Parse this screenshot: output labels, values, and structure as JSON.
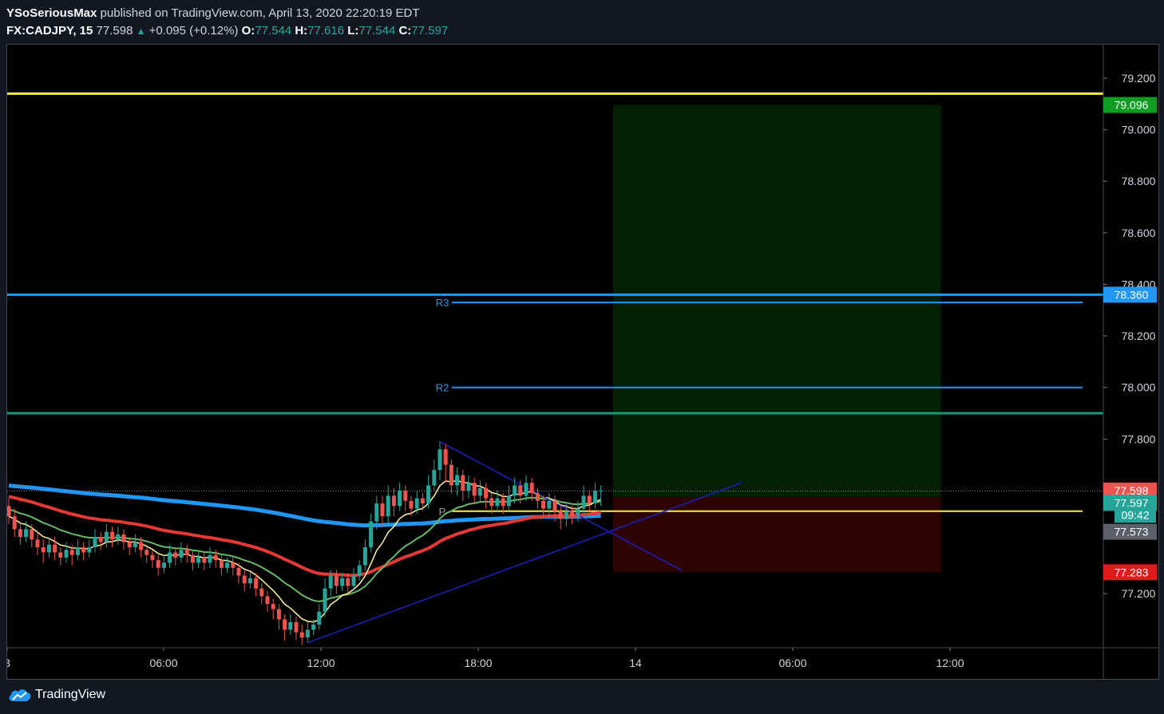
{
  "header": {
    "publisher": "YSoSeriousMax",
    "published_text": "published on TradingView.com, April 13, 2020 22:20:19 EDT",
    "symbol": "FX:CADJPY, 15",
    "last": "77.598",
    "change": "+0.095 (+0.12%)",
    "o_label": "O:",
    "o_value": "77.544",
    "h_label": "H:",
    "h_value": "77.616",
    "l_label": "L:",
    "l_value": "77.544",
    "c_label": "C:",
    "c_value": "77.597"
  },
  "footer": {
    "brand": "TradingView"
  },
  "colors": {
    "up": "#26a69a",
    "down": "#ef5350",
    "blue": "#2196f3",
    "yellow": "#ffeb3b",
    "teal_line": "#1b9a7a",
    "ema_red": "#e53935",
    "ema_green": "#66bb6a",
    "ema_yellow": "#fff59d",
    "trend": "#1e1ebe",
    "profit_zone": "#032003",
    "loss_zone": "#2e0303"
  },
  "chart_data": {
    "type": "candlestick",
    "title": "",
    "xlabel": "",
    "ylabel": "",
    "ylim": [
      76.99,
      79.33
    ],
    "x_ticks": [
      "3",
      "06:00",
      "12:00",
      "18:00",
      "14",
      "06:00",
      "12:00"
    ],
    "y_ticks": [
      "79.200",
      "79.000",
      "78.800",
      "78.600",
      "78.400",
      "78.200",
      "78.000",
      "77.800",
      "77.200"
    ],
    "grid": false,
    "horizontal_lines": [
      {
        "price": 79.14,
        "color": "#ffeb3b",
        "label": ""
      },
      {
        "price": 78.36,
        "color": "#2196f3",
        "label": ""
      },
      {
        "price": 78.33,
        "color": "#2196f3",
        "label": "R3"
      },
      {
        "price": 78.0,
        "color": "#2196f3",
        "label": "R2"
      },
      {
        "price": 77.9,
        "color": "#1b9a7a",
        "label": ""
      },
      {
        "price": 77.52,
        "color": "#ffeb3b",
        "label": "P"
      }
    ],
    "price_tags": [
      {
        "value": "79.096",
        "bg": "#0f9d23",
        "fg": "#ffffff"
      },
      {
        "value": "78.360",
        "bg": "#2196f3",
        "fg": "#ffffff"
      },
      {
        "value": "77.598",
        "bg": "#ef5350",
        "fg": "#ffffff"
      },
      {
        "value": "77.597",
        "bg": "#26a69a",
        "fg": "#ffffff"
      },
      {
        "value": "09:42",
        "bg": "#26a69a",
        "fg": "#ffffff"
      },
      {
        "value": "77.573",
        "bg": "#5d606b",
        "fg": "#ffffff"
      },
      {
        "value": "77.283",
        "bg": "#e01b1b",
        "fg": "#ffffff"
      }
    ],
    "position": {
      "type": "long",
      "entry": 77.573,
      "target": 79.096,
      "stop": 77.283
    },
    "last_price": 77.598,
    "candles": [
      [
        77.54,
        77.5,
        77.57,
        77.47
      ],
      [
        77.5,
        77.45,
        77.53,
        77.42
      ],
      [
        77.45,
        77.42,
        77.48,
        77.39
      ],
      [
        77.42,
        77.45,
        77.48,
        77.4
      ],
      [
        77.45,
        77.41,
        77.47,
        77.38
      ],
      [
        77.41,
        77.38,
        77.44,
        77.35
      ],
      [
        77.38,
        77.36,
        77.41,
        77.32
      ],
      [
        77.36,
        77.39,
        77.42,
        77.34
      ],
      [
        77.39,
        77.36,
        77.42,
        77.33
      ],
      [
        77.36,
        77.34,
        77.38,
        77.31
      ],
      [
        77.34,
        77.37,
        77.4,
        77.32
      ],
      [
        77.37,
        77.35,
        77.39,
        77.31
      ],
      [
        77.35,
        77.38,
        77.41,
        77.33
      ],
      [
        77.38,
        77.36,
        77.4,
        77.33
      ],
      [
        77.36,
        77.38,
        77.41,
        77.34
      ],
      [
        77.38,
        77.42,
        77.45,
        77.36
      ],
      [
        77.42,
        77.4,
        77.44,
        77.37
      ],
      [
        77.4,
        77.44,
        77.47,
        77.38
      ],
      [
        77.44,
        77.41,
        77.46,
        77.38
      ],
      [
        77.41,
        77.43,
        77.46,
        77.39
      ],
      [
        77.43,
        77.4,
        77.45,
        77.37
      ],
      [
        77.4,
        77.38,
        77.42,
        77.35
      ],
      [
        77.38,
        77.4,
        77.43,
        77.36
      ],
      [
        77.4,
        77.37,
        77.42,
        77.34
      ],
      [
        77.37,
        77.35,
        77.39,
        77.32
      ],
      [
        77.35,
        77.33,
        77.37,
        77.3
      ],
      [
        77.33,
        77.3,
        77.35,
        77.27
      ],
      [
        77.3,
        77.32,
        77.35,
        77.28
      ],
      [
        77.32,
        77.36,
        77.39,
        77.3
      ],
      [
        77.36,
        77.34,
        77.38,
        77.31
      ],
      [
        77.34,
        77.37,
        77.4,
        77.32
      ],
      [
        77.37,
        77.35,
        77.39,
        77.32
      ],
      [
        77.35,
        77.32,
        77.37,
        77.29
      ],
      [
        77.32,
        77.34,
        77.36,
        77.3
      ],
      [
        77.34,
        77.32,
        77.36,
        77.29
      ],
      [
        77.32,
        77.35,
        77.38,
        77.3
      ],
      [
        77.35,
        77.33,
        77.37,
        77.3
      ],
      [
        77.33,
        77.3,
        77.35,
        77.27
      ],
      [
        77.3,
        77.32,
        77.34,
        77.28
      ],
      [
        77.32,
        77.3,
        77.34,
        77.27
      ],
      [
        77.3,
        77.27,
        77.32,
        77.24
      ],
      [
        77.27,
        77.24,
        77.29,
        77.21
      ],
      [
        77.24,
        77.26,
        77.28,
        77.22
      ],
      [
        77.26,
        77.22,
        77.28,
        77.19
      ],
      [
        77.22,
        77.19,
        77.24,
        77.16
      ],
      [
        77.19,
        77.16,
        77.21,
        77.13
      ],
      [
        77.16,
        77.14,
        77.18,
        77.1
      ],
      [
        77.14,
        77.1,
        77.16,
        77.06
      ],
      [
        77.1,
        77.06,
        77.12,
        77.02
      ],
      [
        77.06,
        77.09,
        77.12,
        77.04
      ],
      [
        77.09,
        77.05,
        77.11,
        77.02
      ],
      [
        77.05,
        77.03,
        77.08,
        77.0
      ],
      [
        77.03,
        77.06,
        77.09,
        77.01
      ],
      [
        77.06,
        77.08,
        77.1,
        77.04
      ],
      [
        77.08,
        77.13,
        77.16,
        77.06
      ],
      [
        77.13,
        77.22,
        77.26,
        77.11
      ],
      [
        77.22,
        77.27,
        77.29,
        77.19
      ],
      [
        77.27,
        77.23,
        77.29,
        77.2
      ],
      [
        77.23,
        77.26,
        77.28,
        77.21
      ],
      [
        77.26,
        77.23,
        77.28,
        77.2
      ],
      [
        77.23,
        77.27,
        77.3,
        77.21
      ],
      [
        77.27,
        77.31,
        77.33,
        77.25
      ],
      [
        77.31,
        77.38,
        77.41,
        77.29
      ],
      [
        77.38,
        77.48,
        77.51,
        77.36
      ],
      [
        77.48,
        77.55,
        77.58,
        77.45
      ],
      [
        77.55,
        77.5,
        77.58,
        77.46
      ],
      [
        77.5,
        77.58,
        77.62,
        77.47
      ],
      [
        77.58,
        77.54,
        77.61,
        77.5
      ],
      [
        77.54,
        77.6,
        77.63,
        77.52
      ],
      [
        77.6,
        77.56,
        77.62,
        77.52
      ],
      [
        77.56,
        77.53,
        77.58,
        77.5
      ],
      [
        77.53,
        77.57,
        77.6,
        77.51
      ],
      [
        77.57,
        77.55,
        77.59,
        77.52
      ],
      [
        77.55,
        77.62,
        77.66,
        77.53
      ],
      [
        77.62,
        77.68,
        77.72,
        77.6
      ],
      [
        77.68,
        77.76,
        77.79,
        77.64
      ],
      [
        77.76,
        77.7,
        77.78,
        77.63
      ],
      [
        77.7,
        77.62,
        77.72,
        77.59
      ],
      [
        77.62,
        77.66,
        77.69,
        77.58
      ],
      [
        77.66,
        77.6,
        77.68,
        77.56
      ],
      [
        77.6,
        77.63,
        77.66,
        77.57
      ],
      [
        77.63,
        77.58,
        77.65,
        77.55
      ],
      [
        77.58,
        77.61,
        77.64,
        77.56
      ],
      [
        77.61,
        77.57,
        77.63,
        77.53
      ],
      [
        77.57,
        77.54,
        77.59,
        77.51
      ],
      [
        77.54,
        77.57,
        77.6,
        77.52
      ],
      [
        77.57,
        77.54,
        77.59,
        77.51
      ],
      [
        77.54,
        77.58,
        77.62,
        77.52
      ],
      [
        77.58,
        77.62,
        77.65,
        77.55
      ],
      [
        77.62,
        77.58,
        77.64,
        77.55
      ],
      [
        77.58,
        77.63,
        77.66,
        77.56
      ],
      [
        77.63,
        77.59,
        77.65,
        77.56
      ],
      [
        77.59,
        77.56,
        77.61,
        77.53
      ],
      [
        77.56,
        77.53,
        77.58,
        77.5
      ],
      [
        77.53,
        77.56,
        77.59,
        77.5
      ],
      [
        77.56,
        77.52,
        77.58,
        77.48
      ],
      [
        77.52,
        77.49,
        77.54,
        77.45
      ],
      [
        77.49,
        77.52,
        77.55,
        77.46
      ],
      [
        77.52,
        77.5,
        77.54,
        77.47
      ],
      [
        77.5,
        77.53,
        77.56,
        77.48
      ],
      [
        77.53,
        77.58,
        77.62,
        77.51
      ],
      [
        77.58,
        77.55,
        77.6,
        77.52
      ],
      [
        77.55,
        77.6,
        77.63,
        77.53
      ],
      [
        77.6,
        77.6,
        77.62,
        77.54
      ]
    ]
  }
}
